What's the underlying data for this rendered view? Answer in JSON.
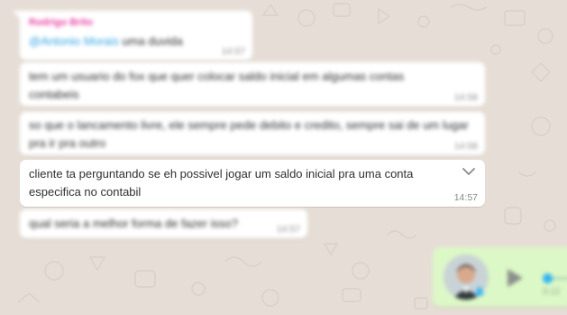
{
  "chat": {
    "messages": [
      {
        "sender": "Rodrigo Brito",
        "quoted_mention": "@Antonio Morais",
        "quoted_text": "uma duvida",
        "time": "14:57",
        "blurred": true
      },
      {
        "text": "tem um usuario do fox que quer colocar saldo inicial em algumas contas contabeis",
        "time": "14:58",
        "blurred": true
      },
      {
        "text": "so que o lancamento livre, ele sempre pede debito e credito, sempre sai de um lugar pra ir pra outro",
        "time": "14:58",
        "blurred": true
      },
      {
        "text": "cliente ta perguntando se eh possivel jogar um saldo inicial pra uma conta especifica no contabil",
        "time": "14:57",
        "blurred": false
      },
      {
        "text": "qual seria a melhor forma de fazer isso?",
        "time": "14:57",
        "blurred": true
      }
    ],
    "voice_note": {
      "play_icon": "play-icon",
      "microphone_icon": "microphone-icon",
      "duration": "0:12"
    }
  },
  "colors": {
    "background": "#e6ded6",
    "bubble_in": "#ffffff",
    "bubble_out": "#dcf8c6",
    "sender_name": "#e542a3",
    "mention": "#2fa5e0",
    "progress_dot": "#30b6f6"
  }
}
